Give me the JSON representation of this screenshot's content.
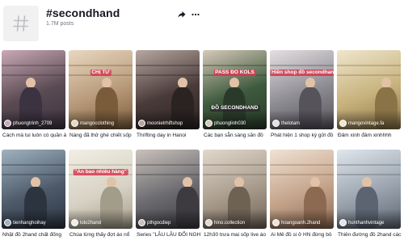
{
  "header": {
    "title": "#secondhand",
    "posts_count": "1.7M posts",
    "share_icon": "share-arrow-icon",
    "more_icon": "more-dots-icon",
    "hashtag_icon": "hashtag-icon"
  },
  "rows": [
    {
      "videos": [
        {
          "author": "phuongtrinh_2709",
          "caption": "Cách mà tui luôn có quần áo",
          "overlay": "",
          "colors": [
            "#5a4a52",
            "#c9a9b5",
            "#3b3340"
          ]
        },
        {
          "author": "mangocclothing",
          "caption": "Nàng đã thử ghé chiết sốp",
          "overlay": "CHỊ TƯ",
          "colors": [
            "#b89a7a",
            "#e8d8c0",
            "#7a5b3a"
          ]
        },
        {
          "author": "moonietrhiftshop",
          "caption": "Thrifting day in Hanoi",
          "overlay": "",
          "colors": [
            "#4a3b3a",
            "#b7a7a0",
            "#2b2222"
          ]
        },
        {
          "author": "phuonglinh030",
          "caption": "Các bạn sẵn sàng săn đồ",
          "overlay": "PASS ĐỒ KOLS",
          "overlay2": "ĐỒ SECONDHAND",
          "colors": [
            "#3e5a3e",
            "#d6c9b8",
            "#2a3a2a"
          ]
        },
        {
          "author": "thelotam",
          "caption": "Phát hiện 1 shop ký gửi đồ",
          "overlay": "Hiền shop đồ secondhand",
          "colors": [
            "#8d8b92",
            "#e4dfe2",
            "#56535a"
          ]
        },
        {
          "author": "mangovintage.fa",
          "caption": "Đảm xinh đảm xinhhhh",
          "overlay": "",
          "colors": [
            "#c7b27d",
            "#efe6cc",
            "#8a7447"
          ]
        }
      ]
    },
    {
      "videos": [
        {
          "author": "tienhanghoihay",
          "caption": "Nhặt đồ 2hand chất đống",
          "overlay": "",
          "colors": [
            "#4e5a6a",
            "#9fb2bf",
            "#2c3440"
          ]
        },
        {
          "author": "lolo2hand",
          "caption": "Chúa từng thấy đợt áo nổ",
          "overlay": "\"An bao nhiêu hàng\"",
          "colors": [
            "#d7d2c4",
            "#f2eee4",
            "#a39c8a"
          ]
        },
        {
          "author": "pthgocdiep",
          "caption": "Series \"LÂU LÂU ĐỔI NGHỀ\"",
          "overlay": "",
          "colors": [
            "#6b6a6f",
            "#c9c1bb",
            "#3d3b40"
          ]
        },
        {
          "author": "hino.collection",
          "caption": "12h30 trưa mai sốp live áo",
          "overlay": "",
          "colors": [
            "#a89b8c",
            "#e1d8cc",
            "#6e6255"
          ]
        },
        {
          "author": "hoangoanh.2hand",
          "caption": "Ai Mê đồ si ở HN đừng bỏ",
          "overlay": "",
          "colors": [
            "#c4a48b",
            "#f0e2d4",
            "#8c6a52"
          ]
        },
        {
          "author": "hunthanhvintage",
          "caption": "Thiên đường đồ 2hand các",
          "overlay": "",
          "colors": [
            "#9aa3ad",
            "#e0e6ec",
            "#5b6470"
          ]
        }
      ]
    }
  ],
  "colors": {
    "text": "#161823",
    "secondary_text": "#75767c",
    "tile_bg": "#f1f1f2"
  }
}
